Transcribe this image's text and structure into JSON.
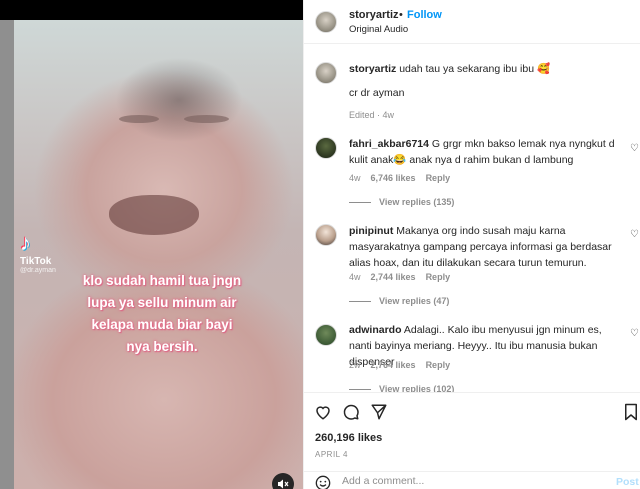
{
  "media": {
    "watermark_name": "TikTok",
    "watermark_handle": "@dr.ayman",
    "caption_lines": [
      "klo sudah hamil tua jngn",
      "lupa ya sellu minum air",
      "kelapa muda biar bayi",
      "nya bersih."
    ],
    "mute_icon": "speaker-muted-icon"
  },
  "header": {
    "username": "storyartiz",
    "dot": "•",
    "follow_label": "Follow",
    "audio": "Original Audio"
  },
  "post_caption": {
    "username": "storyartiz",
    "text": "udah tau ya sekarang ibu ibu 🥰",
    "credit": "cr dr ayman",
    "edited": "Edited · 4w"
  },
  "comments": [
    {
      "username": "fahri_akbar6714",
      "text": "G grgr mkn bakso lemak nya nyngkut d kulit anak😂 anak nya d rahim bukan d lambung",
      "age": "4w",
      "likes": "6,746 likes",
      "reply": "Reply",
      "view_replies": "View replies (135)"
    },
    {
      "username": "pinipinut",
      "text": "Makanya org indo susah maju karna masyarakatnya gampang percaya informasi ga berdasar alias hoax, dan itu dilakukan secara turun temurun.",
      "age": "4w",
      "likes": "2,744 likes",
      "reply": "Reply",
      "view_replies": "View replies (47)"
    },
    {
      "username": "adwinardo",
      "text": "Adalagi.. Kalo ibu menyusui jgn minum es, nanti bayinya meriang. Heyyy.. Itu ibu manusia bukan dispenser",
      "age": "2w",
      "likes": "2,764 likes",
      "reply": "Reply",
      "view_replies": "View replies (102)"
    }
  ],
  "actions": {
    "likes": "260,196 likes",
    "date": "APRIL 4",
    "comment_placeholder": "Add a comment...",
    "post_label": "Post"
  },
  "colors": {
    "link_blue": "#0095f6",
    "muted_text": "#8e8e8e",
    "caption_pink": "#e6708c"
  }
}
